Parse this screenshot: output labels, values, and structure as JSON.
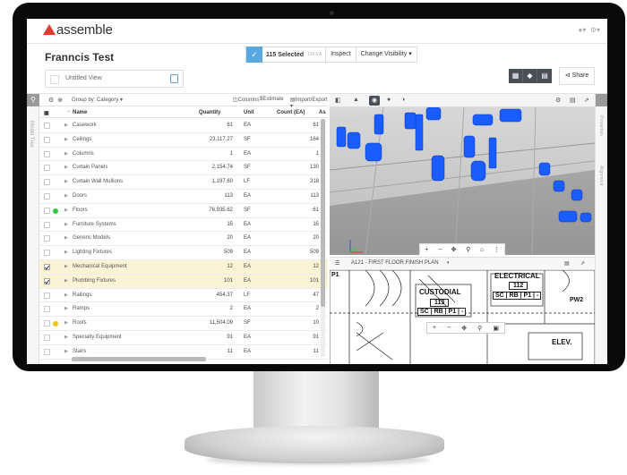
{
  "app": {
    "name": "assemble"
  },
  "header": {
    "project_title": "Franncis Test",
    "view_name": "Untitled View",
    "selection_count": "115 Selected",
    "selection_sub": "115 EA",
    "inspect_label": "Inspect",
    "change_visibility_label": "Change Visibility",
    "share_label": "Share"
  },
  "left_rail": {
    "vertical_label": "Model Tree"
  },
  "right_rail": {
    "labels": [
      "Properties",
      "Alignment"
    ]
  },
  "table_toolbar": {
    "group_by": "Group by: Category",
    "columns": "Columns",
    "estimate": "Estimate",
    "import_export": "Import/Export"
  },
  "table": {
    "headers": {
      "name": "Name",
      "quantity": "Quantity",
      "unit": "Unit",
      "count": "Count (EA)",
      "extra": "As"
    },
    "rows": [
      {
        "name": "Casework",
        "quantity": "61",
        "unit": "EA",
        "count": "61",
        "checked": false,
        "dot": ""
      },
      {
        "name": "Ceilings",
        "quantity": "23,117.27",
        "unit": "SF",
        "count": "164",
        "checked": false,
        "dot": ""
      },
      {
        "name": "Columns",
        "quantity": "1",
        "unit": "EA",
        "count": "1",
        "checked": false,
        "dot": ""
      },
      {
        "name": "Curtain Panels",
        "quantity": "2,154.74",
        "unit": "SF",
        "count": "130",
        "checked": false,
        "dot": ""
      },
      {
        "name": "Curtain Wall Mullions",
        "quantity": "1,197.60",
        "unit": "LF",
        "count": "318",
        "checked": false,
        "dot": ""
      },
      {
        "name": "Doors",
        "quantity": "113",
        "unit": "EA",
        "count": "113",
        "checked": false,
        "dot": ""
      },
      {
        "name": "Floors",
        "quantity": "76,935.62",
        "unit": "SF",
        "count": "61",
        "checked": false,
        "dot": "#2ecc40"
      },
      {
        "name": "Furniture Systems",
        "quantity": "15",
        "unit": "EA",
        "count": "15",
        "checked": false,
        "dot": ""
      },
      {
        "name": "Generic Models",
        "quantity": "20",
        "unit": "EA",
        "count": "20",
        "checked": false,
        "dot": ""
      },
      {
        "name": "Lighting Fixtures",
        "quantity": "509",
        "unit": "EA",
        "count": "509",
        "checked": false,
        "dot": ""
      },
      {
        "name": "Mechanical Equipment",
        "quantity": "12",
        "unit": "EA",
        "count": "12",
        "checked": true,
        "dot": ""
      },
      {
        "name": "Plumbing Fixtures",
        "quantity": "101",
        "unit": "EA",
        "count": "101",
        "checked": true,
        "dot": ""
      },
      {
        "name": "Railings",
        "quantity": "454.37",
        "unit": "LF",
        "count": "47",
        "checked": false,
        "dot": ""
      },
      {
        "name": "Ramps",
        "quantity": "2",
        "unit": "EA",
        "count": "2",
        "checked": false,
        "dot": ""
      },
      {
        "name": "Roofs",
        "quantity": "11,504.09",
        "unit": "SF",
        "count": "10",
        "checked": false,
        "dot": "#f1c40f"
      },
      {
        "name": "Specialty Equipment",
        "quantity": "91",
        "unit": "EA",
        "count": "91",
        "checked": false,
        "dot": ""
      },
      {
        "name": "Stairs",
        "quantity": "11",
        "unit": "EA",
        "count": "11",
        "checked": false,
        "dot": ""
      }
    ]
  },
  "plan_view": {
    "title": "A121 - FIRST FLOOR FINISH PLAN",
    "labels": {
      "electrical": "ELECTRICAL",
      "electrical_num": "112",
      "electrical_tags": "SC | RB | P1 | -",
      "custodial": "CUSTODIAL",
      "custodial_num": "113",
      "custodial_tags": "SC | RB | P1 | -",
      "elev": "ELEV.",
      "pw2": "PW2",
      "p1": "P1"
    }
  },
  "colors": {
    "accent": "#58a8df",
    "model_blue": "#1a5cff",
    "logo": "#e03a2f"
  }
}
